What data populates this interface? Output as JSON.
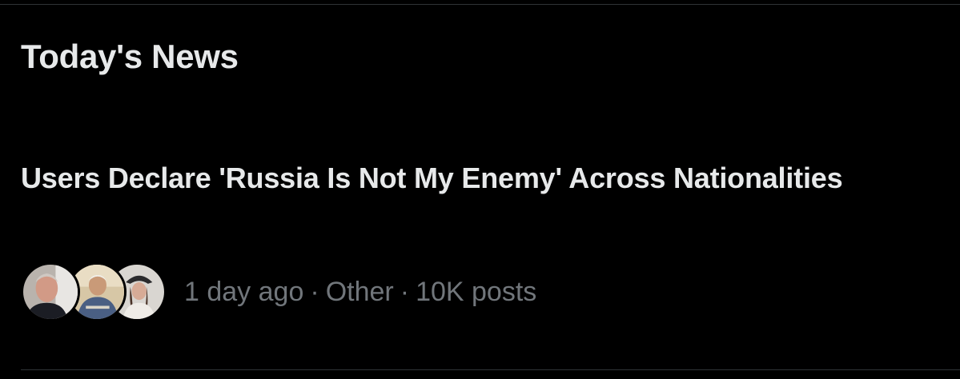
{
  "section": {
    "title": "Today's News"
  },
  "news_item": {
    "headline": "Users Declare 'Russia Is Not My Enemy' Across Nationalities",
    "time": "1 day ago",
    "category": "Other",
    "post_count": "10K posts",
    "separator": "·",
    "avatars": [
      {
        "name": "avatar-older-man"
      },
      {
        "name": "avatar-man-outdoors"
      },
      {
        "name": "avatar-woman-hat"
      }
    ]
  },
  "colors": {
    "background": "#000000",
    "primary_text": "#e7e9ea",
    "secondary_text": "#71767b",
    "divider": "#2f3336"
  }
}
